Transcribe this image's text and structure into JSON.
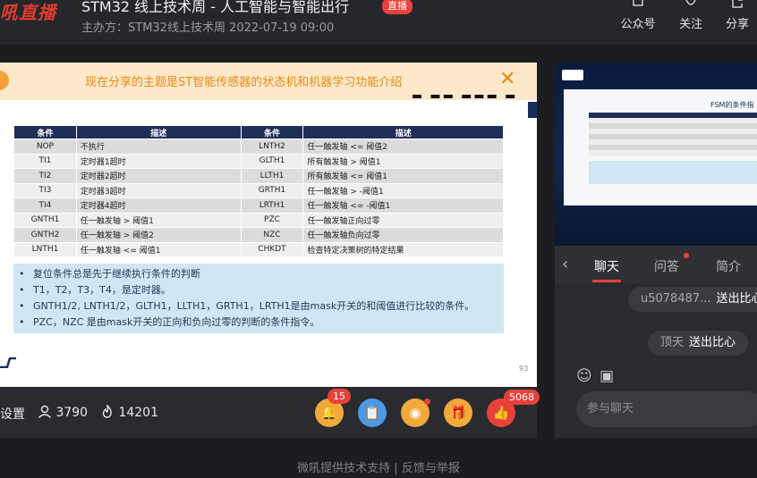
{
  "header": {
    "logo": "吼直播",
    "title": "STM32 线上技术周 - 人工智能与智能出行",
    "live_badge": "直播",
    "organizer": "主办方：STM32线上技术周   2022-07-19 09:00",
    "actions": [
      {
        "label": "公众号",
        "icon": "wechat-account-icon"
      },
      {
        "label": "关注",
        "icon": "follow-icon"
      },
      {
        "label": "分享",
        "icon": "share-icon"
      }
    ]
  },
  "slide": {
    "topic": "现在分享的主题是ST智能传感器的状态机和机器学习功能介绍",
    "headers": [
      "条件",
      "描述",
      "条件",
      "描述"
    ],
    "rows": [
      [
        "NOP",
        "不执行",
        "LNTH2",
        "任一触发轴 <= 阈值2"
      ],
      [
        "TI1",
        "定时器1超时",
        "GLTH1",
        "所有触发轴 > 阈值1"
      ],
      [
        "TI2",
        "定时器2超时",
        "LLTH1",
        "所有触发轴 <= 阈值1"
      ],
      [
        "TI3",
        "定时器3超时",
        "GRTH1",
        "任一触发轴 > -阈值1"
      ],
      [
        "TI4",
        "定时器4超时",
        "LRTH1",
        "任一触发轴 <= -阈值1"
      ],
      [
        "GNTH1",
        "任一触发轴 > 阈值1",
        "PZC",
        "任一触发轴正向过零"
      ],
      [
        "GNTH2",
        "任一触发轴 > 阈值2",
        "NZC",
        "任一触发轴负向过零"
      ],
      [
        "LNTH1",
        "任一触发轴 <= 阈值1",
        "CHKDT",
        "检查特定决策树的特定结果"
      ]
    ],
    "notes": [
      "复位条件总是先于继续执行条件的判断",
      "T1，T2，T3，T4，是定时器。",
      "GNTH1/2, LNTH1/2，GLTH1，LLTH1，GRTH1，LRTH1是由mask开关的和阈值进行比较的条件。",
      "PZC，NZC 是由mask开关的正向和负向过零的判断的条件指令。"
    ],
    "page_number": "93"
  },
  "controls": {
    "settings": "设置",
    "viewers": "3790",
    "likes_count": "14201",
    "notify_badge": "15",
    "like_badge": "5068"
  },
  "thumbnail": {
    "title": "FSM的条件指"
  },
  "panel": {
    "tabs": [
      "聊天",
      "问答",
      "简介"
    ],
    "messages": [
      {
        "user": "u5078487...",
        "text": "送出比心"
      },
      {
        "user": "顶天",
        "text": "送出比心"
      }
    ],
    "input_placeholder": "参与聊天"
  },
  "footer": "微吼提供技术支持  |  反馈与举报",
  "colors": {
    "accent": "#e8413a",
    "banner_bg": "#fde9c9",
    "banner_text": "#e48a17",
    "table_header": "#1f2f58",
    "notes_bg": "#cfe7f4"
  }
}
